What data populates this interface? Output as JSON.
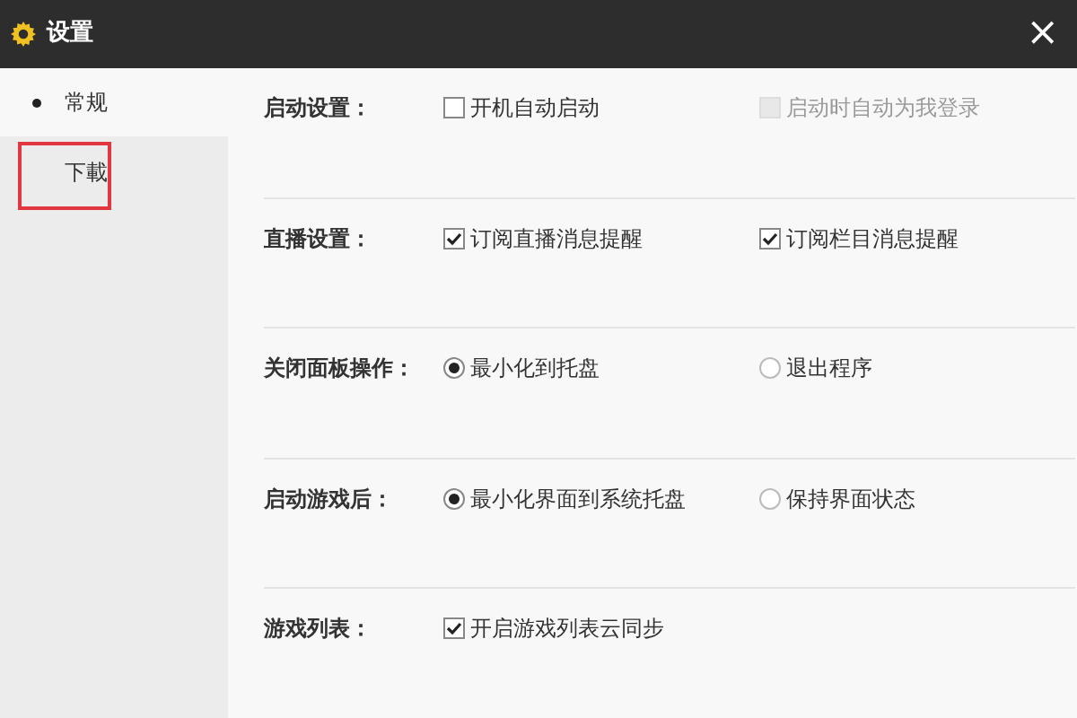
{
  "window": {
    "title": "设置",
    "close": "×"
  },
  "sidebar": {
    "items": [
      {
        "label": "常规",
        "selected": true,
        "highlighted": false
      },
      {
        "label": "下載",
        "selected": false,
        "highlighted": true
      }
    ]
  },
  "sections": [
    {
      "label": "启动设置：",
      "options": [
        {
          "kind": "checkbox",
          "label": "开机自动启动",
          "checked": false,
          "disabled": false
        },
        {
          "kind": "checkbox",
          "label": "启动时自动为我登录",
          "checked": false,
          "disabled": true
        }
      ]
    },
    {
      "label": "直播设置：",
      "options": [
        {
          "kind": "checkbox",
          "label": "订阅直播消息提醒",
          "checked": true,
          "disabled": false
        },
        {
          "kind": "checkbox",
          "label": "订阅栏目消息提醒",
          "checked": true,
          "disabled": false
        }
      ]
    },
    {
      "label": "关闭面板操作：",
      "options": [
        {
          "kind": "radio",
          "label": "最小化到托盘",
          "checked": true,
          "disabled": false
        },
        {
          "kind": "radio",
          "label": "退出程序",
          "checked": false,
          "disabled": false
        }
      ]
    },
    {
      "label": "启动游戏后：",
      "options": [
        {
          "kind": "radio",
          "label": "最小化界面到系统托盘",
          "checked": true,
          "disabled": false
        },
        {
          "kind": "radio",
          "label": "保持界面状态",
          "checked": false,
          "disabled": false
        }
      ]
    },
    {
      "label": "游戏列表：",
      "options": [
        {
          "kind": "checkbox",
          "label": "开启游戏列表云同步",
          "checked": true,
          "disabled": false
        }
      ]
    }
  ]
}
